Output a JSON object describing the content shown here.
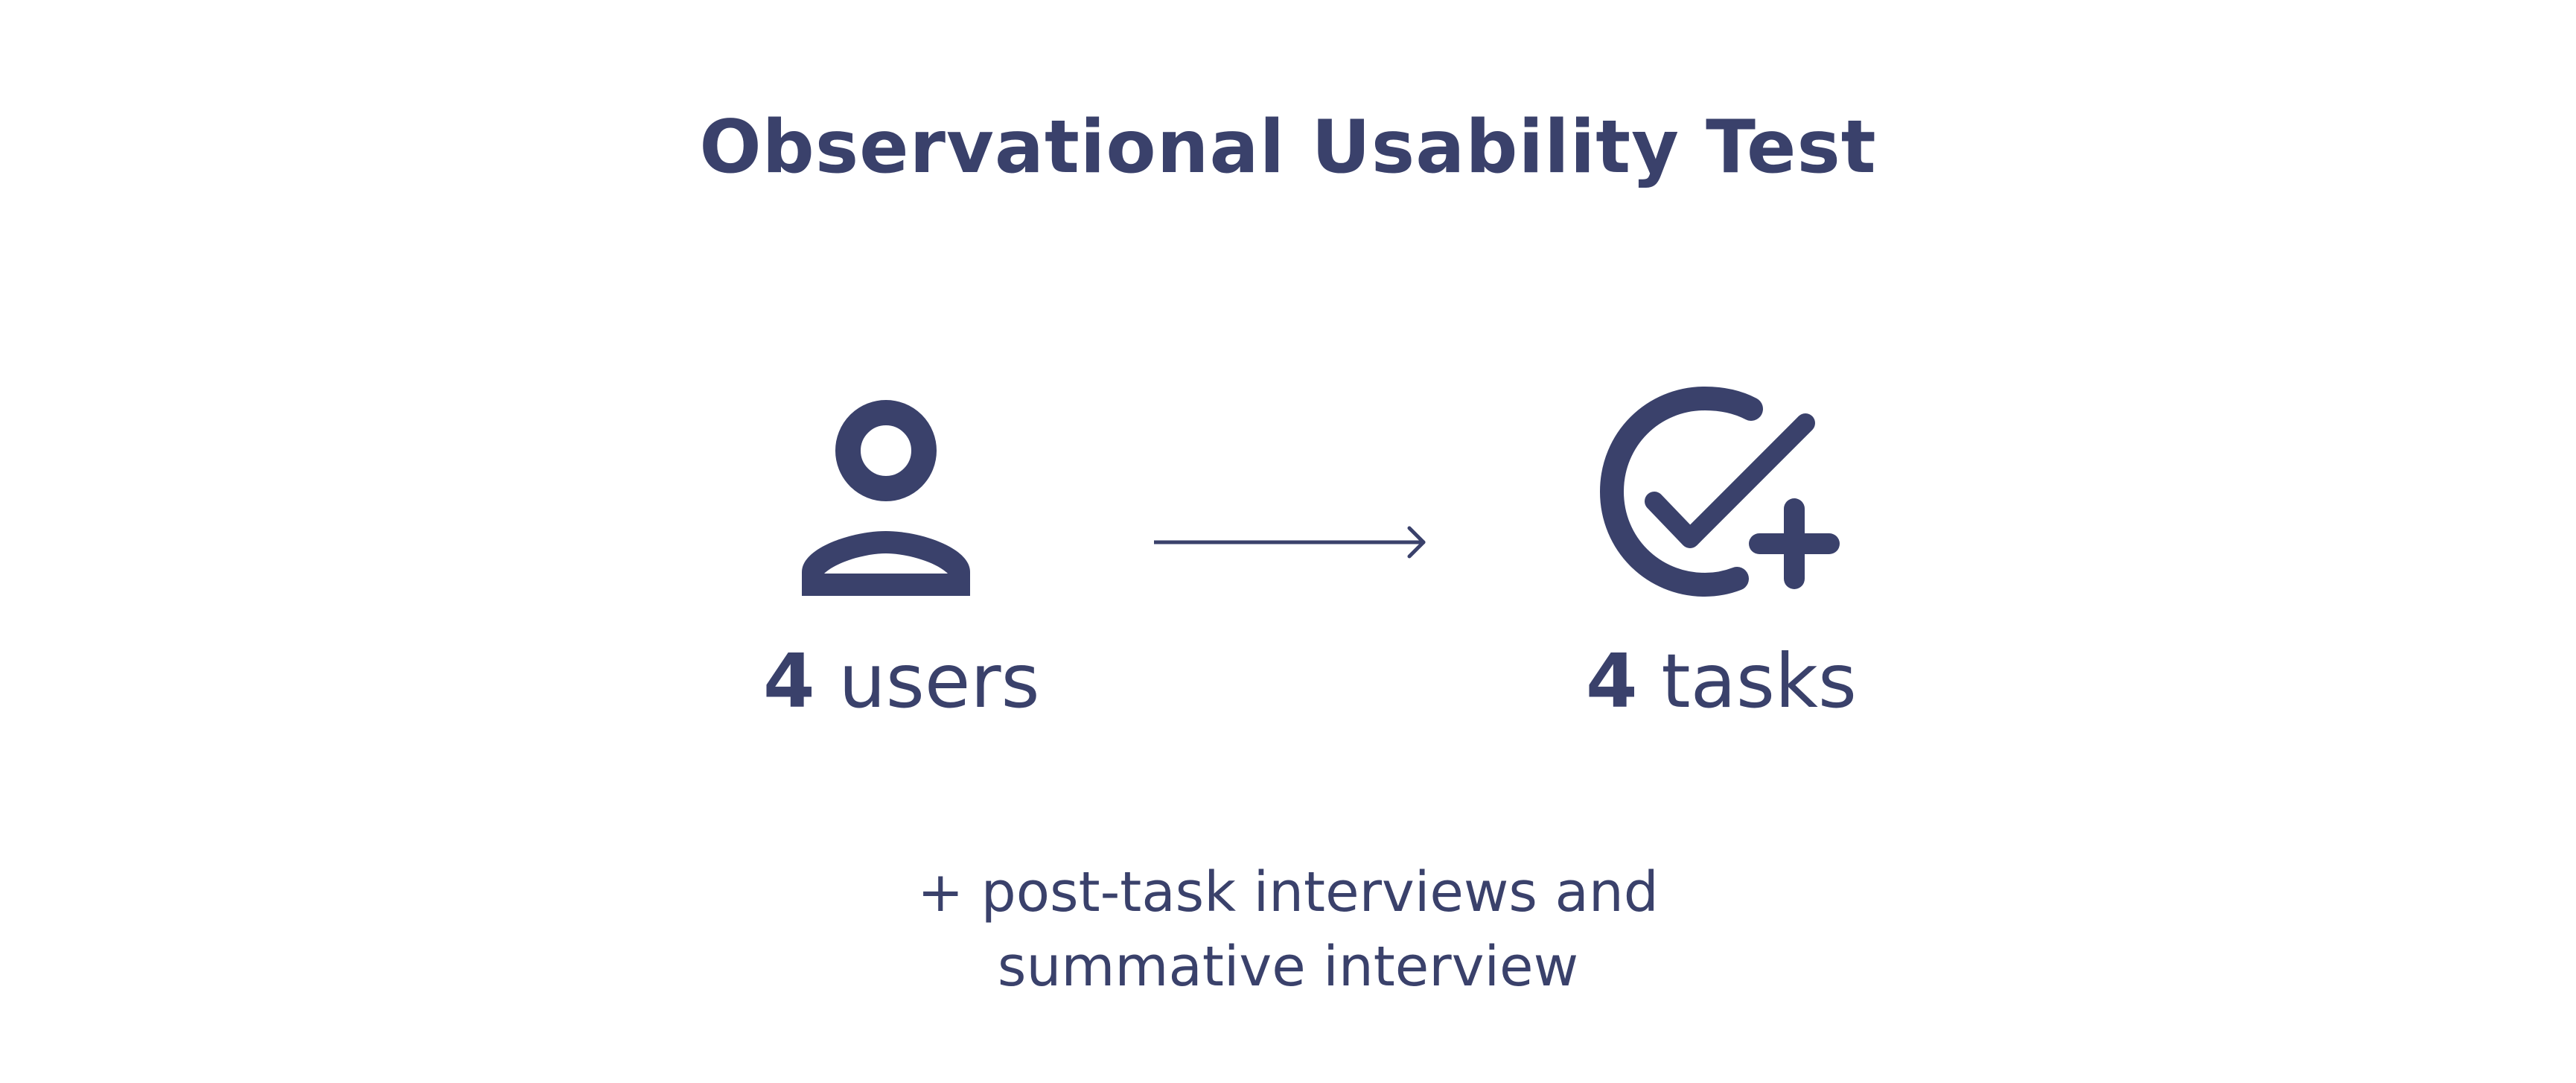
{
  "title": "Observational Usability Test",
  "accent_color": "#3a416b",
  "users": {
    "icon": "user-icon",
    "count": "4",
    "label": "users"
  },
  "connector": {
    "icon": "arrow-right-icon"
  },
  "tasks": {
    "icon": "task-check-add-icon",
    "count": "4",
    "label": "tasks"
  },
  "footnote": {
    "line1": "+ post-task interviews and",
    "line2": "summative interview"
  }
}
